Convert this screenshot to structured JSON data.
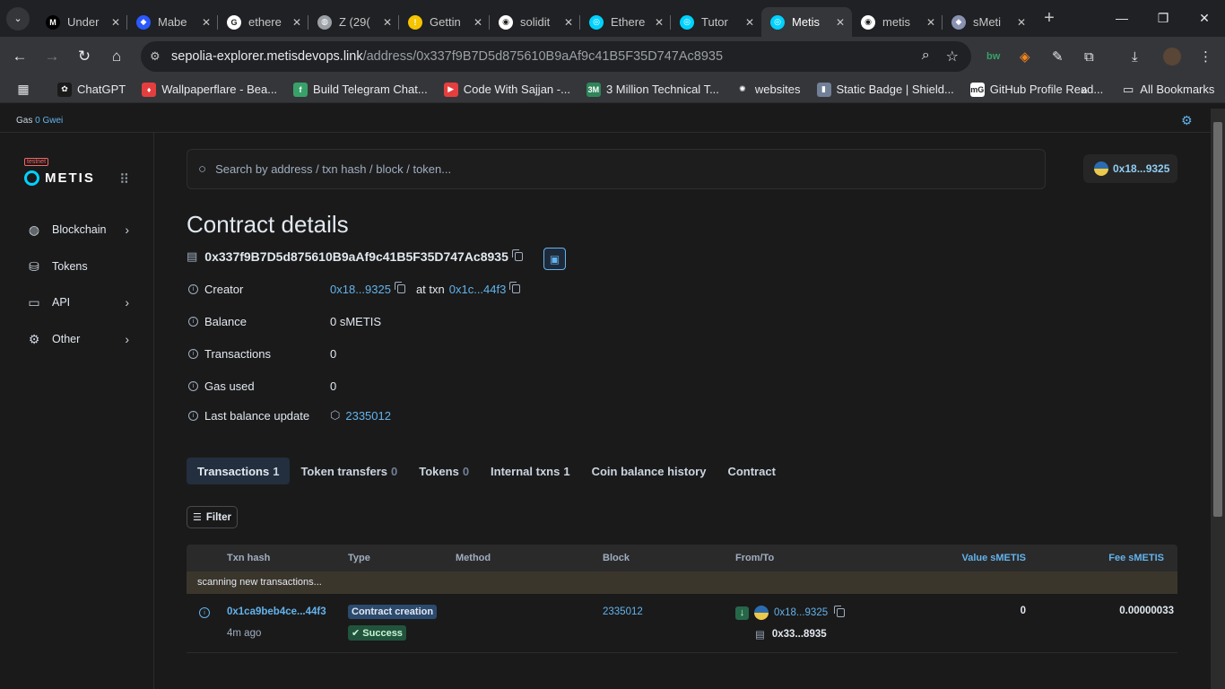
{
  "browser": {
    "tabs": [
      {
        "title": "Under",
        "color": "#000000",
        "glyph": "M"
      },
      {
        "title": "Mabe",
        "color": "#2b59ff",
        "glyph": "◆"
      },
      {
        "title": "ethere",
        "color": "#ffffff",
        "glyph": "G"
      },
      {
        "title": "Z (29(",
        "color": "#9aa0a6",
        "glyph": "◍"
      },
      {
        "title": "Gettin",
        "color": "#f6c400",
        "glyph": "!"
      },
      {
        "title": "solidit",
        "color": "#ffffff",
        "glyph": "◉"
      },
      {
        "title": "Ethere",
        "color": "#00d2ff",
        "glyph": "◎"
      },
      {
        "title": "Tutor",
        "color": "#00d2ff",
        "glyph": "◎"
      },
      {
        "title": "Metis",
        "color": "#00d2ff",
        "glyph": "◎"
      },
      {
        "title": "metis",
        "color": "#ffffff",
        "glyph": "◉"
      },
      {
        "title": "sMeti",
        "color": "#8a92b2",
        "glyph": "◆"
      }
    ],
    "active_tab_index": 8,
    "url_host": "sepolia-explorer.metisdevops.link",
    "url_path": "/address/0x337f9B7D5d875610B9aAf9c41B5F35D747Ac8935",
    "bookmarks": [
      {
        "label": "ChatGPT",
        "color": "#1a1a1a",
        "glyph": "✿"
      },
      {
        "label": "Wallpaperflare - Bea...",
        "color": "#e53e3e",
        "glyph": "♦"
      },
      {
        "label": "Build Telegram Chat...",
        "color": "#38a169",
        "glyph": "f"
      },
      {
        "label": "Code With Sajjan -...",
        "color": "#e53e3e",
        "glyph": "▶"
      },
      {
        "label": "3 Million Technical T...",
        "color": "#2f855a",
        "glyph": "3M"
      },
      {
        "label": "websites",
        "color": "#35363a",
        "glyph": "✺"
      },
      {
        "label": "Static Badge | Shield...",
        "color": "#718096",
        "glyph": "▮"
      },
      {
        "label": "GitHub Profile Read...",
        "color": "#ffffff",
        "glyph": "mG"
      }
    ],
    "all_bookmarks": "All Bookmarks"
  },
  "topbar": {
    "gas_label": "Gas",
    "gas_value": "0 Gwei"
  },
  "logo": {
    "badge": "testnet",
    "name": "METIS"
  },
  "sidebar": {
    "items": [
      {
        "label": "Blockchain",
        "icon": "globe-icon",
        "chevron": true
      },
      {
        "label": "Tokens",
        "icon": "coins-icon",
        "chevron": false
      },
      {
        "label": "API",
        "icon": "api-icon",
        "chevron": true
      },
      {
        "label": "Other",
        "icon": "gear-icon",
        "chevron": true
      }
    ]
  },
  "search": {
    "placeholder": "Search by address / txn hash / block / token..."
  },
  "account": {
    "label": "0x18...9325"
  },
  "page": {
    "title": "Contract details",
    "address": "0x337f9B7D5d875610B9aAf9c41B5F35D747Ac8935"
  },
  "details": {
    "creator_label": "Creator",
    "creator_addr": "0x18...9325",
    "creator_at": "at txn",
    "creator_txn": "0x1c...44f3",
    "balance_label": "Balance",
    "balance_value": "0 sMETIS",
    "transactions_label": "Transactions",
    "transactions_value": "0",
    "gas_label": "Gas used",
    "gas_value": "0",
    "last_update_label": "Last balance update",
    "last_update_value": "2335012"
  },
  "tabs": [
    {
      "label": "Transactions",
      "count": "1"
    },
    {
      "label": "Token transfers",
      "count": "0"
    },
    {
      "label": "Tokens",
      "count": "0"
    },
    {
      "label": "Internal txns",
      "count": "1"
    },
    {
      "label": "Coin balance history",
      "count": ""
    },
    {
      "label": "Contract",
      "count": ""
    }
  ],
  "filter_label": "Filter",
  "table": {
    "headers": {
      "txn_hash": "Txn hash",
      "type": "Type",
      "method": "Method",
      "block": "Block",
      "from_to": "From/To",
      "value": "Value sMETIS",
      "fee": "Fee sMETIS"
    },
    "scanning": "scanning new transactions...",
    "rows": [
      {
        "hash": "0x1ca9beb4ce...44f3",
        "age": "4m ago",
        "type": "Contract creation",
        "status": "Success",
        "block": "2335012",
        "from": "0x18...9325",
        "to": "0x33...8935",
        "value": "0",
        "fee": "0.00000033"
      }
    ]
  }
}
